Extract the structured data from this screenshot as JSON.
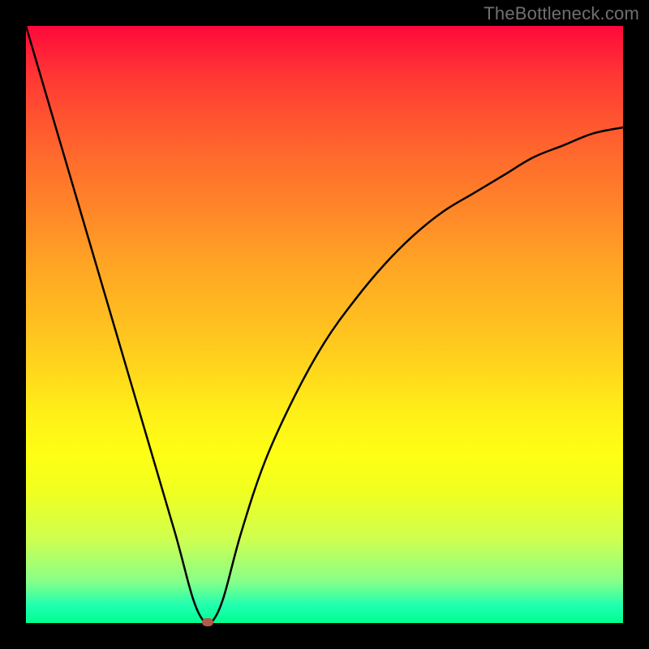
{
  "watermark": "TheBottleneck.com",
  "chart_data": {
    "type": "line",
    "title": "",
    "xlabel": "",
    "ylabel": "",
    "xlim": [
      0,
      100
    ],
    "ylim": [
      0,
      100
    ],
    "grid": false,
    "legend": false,
    "gradient_bands": [
      {
        "band": "high-bottleneck",
        "color": "#ff083a",
        "y_pct_from_top": 0
      },
      {
        "band": "mid-bottleneck",
        "color": "#ffd81c",
        "y_pct_from_top": 58
      },
      {
        "band": "low-bottleneck",
        "color": "#00ff90",
        "y_pct_from_top": 100
      }
    ],
    "series": [
      {
        "name": "bottleneck-curve",
        "x": [
          0,
          5,
          10,
          15,
          20,
          25,
          28,
          30,
          31,
          33,
          36,
          40,
          45,
          50,
          55,
          60,
          65,
          70,
          75,
          80,
          85,
          90,
          95,
          100
        ],
        "values": [
          100,
          83,
          66,
          49,
          32,
          15,
          4,
          0,
          0,
          4,
          15,
          27,
          38,
          47,
          54,
          60,
          65,
          69,
          72,
          75,
          78,
          80,
          82,
          83
        ]
      }
    ],
    "minimum_point": {
      "x": 30.5,
      "y": 0,
      "color": "#b15a4a"
    }
  }
}
